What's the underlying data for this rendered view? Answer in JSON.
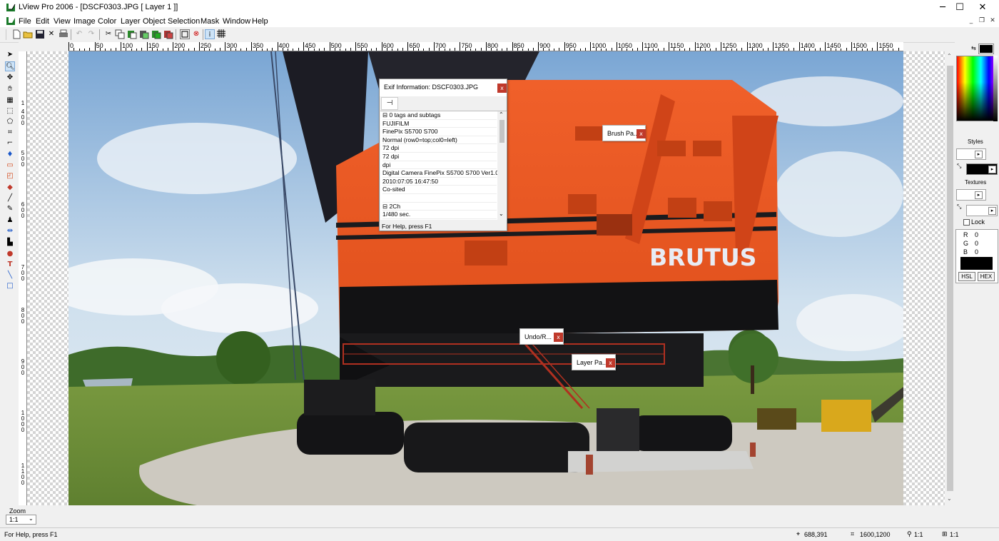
{
  "window": {
    "title": "LView Pro 2006 - [DSCF0303.JPG [ Layer 1 ]]",
    "controls": {
      "minimize": "─",
      "maximize": "☐",
      "close": "✕"
    },
    "mdi_controls": {
      "minimize": "_",
      "restore": "❐",
      "close": "✕"
    }
  },
  "menu": [
    "File",
    "Edit",
    "View",
    "Image",
    "Color",
    "Layer",
    "Object",
    "Selection",
    "Mask",
    "Window",
    "Help"
  ],
  "ruler": {
    "h_labels": [
      "0",
      "50",
      "100",
      "150",
      "200",
      "250",
      "300",
      "350",
      "400",
      "450",
      "500",
      "550",
      "600",
      "650",
      "700",
      "750",
      "800",
      "850",
      "900",
      "950",
      "1000",
      "1050",
      "1100",
      "1150",
      "1200",
      "1250",
      "1300",
      "1350",
      "1400",
      "1450",
      "1500",
      "1550"
    ],
    "v_labels": [
      "1",
      "4",
      "0",
      "0",
      "5",
      "0",
      "0",
      "6",
      "0",
      "0",
      "7",
      "0",
      "0",
      "8",
      "0",
      "0",
      "9",
      "0",
      "0",
      "1",
      "0",
      "0",
      "0",
      "1",
      "1",
      "0",
      "0"
    ]
  },
  "photo": {
    "sign_text": "BRUTUS"
  },
  "exif": {
    "title": "Exif Information: DSCF0303.JPG",
    "close": "x",
    "pin_icon": "pin-icon",
    "rows": [
      "⊟ 0 tags and subtags",
      "FUJIFILM",
      "FinePix S5700 S700",
      "Normal (row0=top;col0=left)",
      "72 dpi",
      "72 dpi",
      "dpi",
      "Digital Camera FinePix S5700 S700 Ver1.02",
      "2010:07:05 16:47:50",
      "Co-sited",
      "",
      "⊟ 2Ch",
      "1/480 sec."
    ],
    "status": "For Help, press F1"
  },
  "floating_panels": [
    {
      "label": "Brush Pa...",
      "close": "x"
    },
    {
      "label": "Undo/R...",
      "close": "x"
    },
    {
      "label": "Layer Pa...",
      "close": "x"
    }
  ],
  "right_panel": {
    "styles_label": "Styles",
    "textures_label": "Textures",
    "lock_label": "Lock",
    "r_label": "R",
    "r_value": "0",
    "g_label": "G",
    "g_value": "0",
    "b_label": "B",
    "b_value": "0",
    "hsl_button": "HSL",
    "hex_button": "HEX"
  },
  "zoom": {
    "label": "Zoom",
    "value": "1:1"
  },
  "status": {
    "help": "For Help, press F1",
    "cursor": "688,391",
    "size": "1600,1200",
    "zoom": "1:1",
    "ratio": "1:1"
  },
  "colors": {
    "accent_close": "#c0392b",
    "exif_bg": "#f0f0f0"
  }
}
